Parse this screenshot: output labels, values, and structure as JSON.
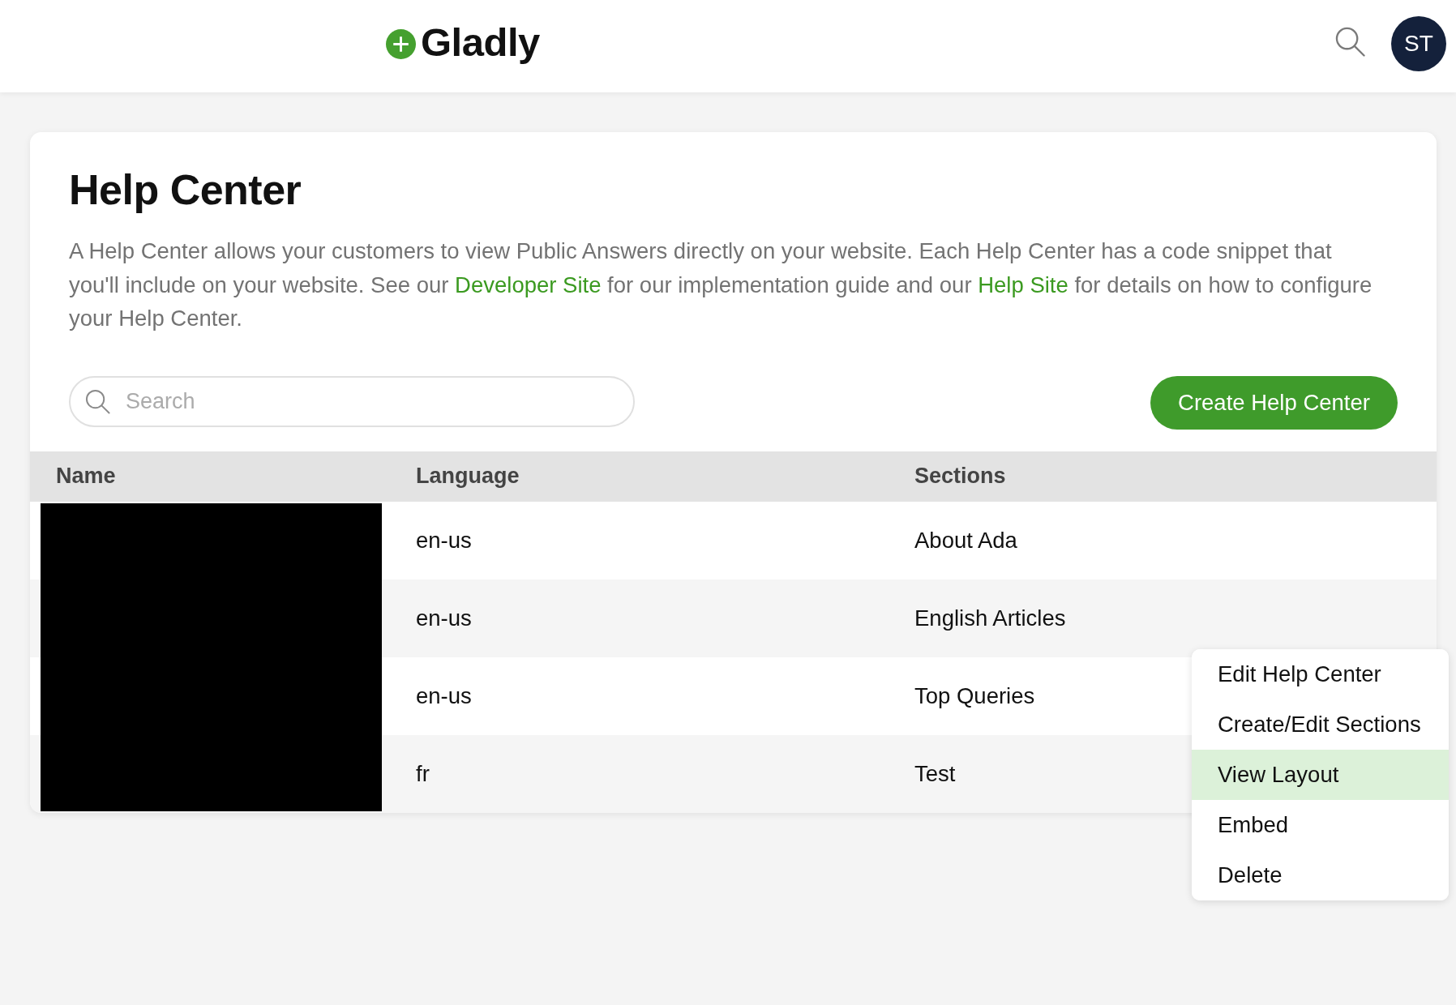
{
  "header": {
    "logo": {
      "text": "Gladly"
    },
    "avatar": {
      "initials": "ST"
    }
  },
  "help_center": {
    "title": "Help Center",
    "description": [
      {
        "kind": "text",
        "text": "A Help Center allows your customers to view Public Answers directly on your website. Each Help Center has a code snippet that you'll include on your website. See our "
      },
      {
        "kind": "link",
        "text": "Developer Site"
      },
      {
        "kind": "text",
        "text": " for our implementation guide and our "
      },
      {
        "kind": "link",
        "text": "Help Site"
      },
      {
        "kind": "text",
        "text": " for details on how to configure your Help Center."
      }
    ],
    "search": {
      "placeholder": "Search"
    },
    "create_button": {
      "label": "Create Help Center"
    },
    "table": {
      "columns": [
        {
          "label": "Name"
        },
        {
          "label": "Language"
        },
        {
          "label": "Sections"
        }
      ],
      "rows": [
        {
          "language": "en-us",
          "sections": "About Ada"
        },
        {
          "language": "en-us",
          "sections": "English Articles"
        },
        {
          "language": "en-us",
          "sections": "Top Queries"
        },
        {
          "language": "fr",
          "sections": "Test"
        }
      ]
    }
  },
  "row_menu": {
    "items": [
      {
        "label": "Edit Help Center",
        "selected": false
      },
      {
        "label": "Create/Edit Sections",
        "selected": false
      },
      {
        "label": "View Layout",
        "selected": true
      },
      {
        "label": "Embed",
        "selected": false
      },
      {
        "label": "Delete",
        "selected": false
      }
    ]
  }
}
